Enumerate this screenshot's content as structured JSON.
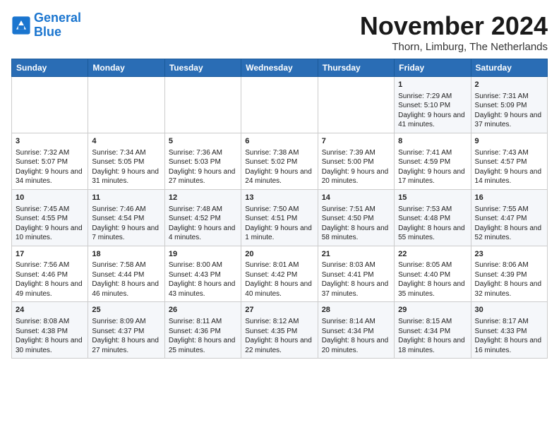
{
  "header": {
    "logo_line1": "General",
    "logo_line2": "Blue",
    "month": "November 2024",
    "location": "Thorn, Limburg, The Netherlands"
  },
  "days_of_week": [
    "Sunday",
    "Monday",
    "Tuesday",
    "Wednesday",
    "Thursday",
    "Friday",
    "Saturday"
  ],
  "weeks": [
    [
      {
        "day": "",
        "info": ""
      },
      {
        "day": "",
        "info": ""
      },
      {
        "day": "",
        "info": ""
      },
      {
        "day": "",
        "info": ""
      },
      {
        "day": "",
        "info": ""
      },
      {
        "day": "1",
        "info": "Sunrise: 7:29 AM\nSunset: 5:10 PM\nDaylight: 9 hours and 41 minutes."
      },
      {
        "day": "2",
        "info": "Sunrise: 7:31 AM\nSunset: 5:09 PM\nDaylight: 9 hours and 37 minutes."
      }
    ],
    [
      {
        "day": "3",
        "info": "Sunrise: 7:32 AM\nSunset: 5:07 PM\nDaylight: 9 hours and 34 minutes."
      },
      {
        "day": "4",
        "info": "Sunrise: 7:34 AM\nSunset: 5:05 PM\nDaylight: 9 hours and 31 minutes."
      },
      {
        "day": "5",
        "info": "Sunrise: 7:36 AM\nSunset: 5:03 PM\nDaylight: 9 hours and 27 minutes."
      },
      {
        "day": "6",
        "info": "Sunrise: 7:38 AM\nSunset: 5:02 PM\nDaylight: 9 hours and 24 minutes."
      },
      {
        "day": "7",
        "info": "Sunrise: 7:39 AM\nSunset: 5:00 PM\nDaylight: 9 hours and 20 minutes."
      },
      {
        "day": "8",
        "info": "Sunrise: 7:41 AM\nSunset: 4:59 PM\nDaylight: 9 hours and 17 minutes."
      },
      {
        "day": "9",
        "info": "Sunrise: 7:43 AM\nSunset: 4:57 PM\nDaylight: 9 hours and 14 minutes."
      }
    ],
    [
      {
        "day": "10",
        "info": "Sunrise: 7:45 AM\nSunset: 4:55 PM\nDaylight: 9 hours and 10 minutes."
      },
      {
        "day": "11",
        "info": "Sunrise: 7:46 AM\nSunset: 4:54 PM\nDaylight: 9 hours and 7 minutes."
      },
      {
        "day": "12",
        "info": "Sunrise: 7:48 AM\nSunset: 4:52 PM\nDaylight: 9 hours and 4 minutes."
      },
      {
        "day": "13",
        "info": "Sunrise: 7:50 AM\nSunset: 4:51 PM\nDaylight: 9 hours and 1 minute."
      },
      {
        "day": "14",
        "info": "Sunrise: 7:51 AM\nSunset: 4:50 PM\nDaylight: 8 hours and 58 minutes."
      },
      {
        "day": "15",
        "info": "Sunrise: 7:53 AM\nSunset: 4:48 PM\nDaylight: 8 hours and 55 minutes."
      },
      {
        "day": "16",
        "info": "Sunrise: 7:55 AM\nSunset: 4:47 PM\nDaylight: 8 hours and 52 minutes."
      }
    ],
    [
      {
        "day": "17",
        "info": "Sunrise: 7:56 AM\nSunset: 4:46 PM\nDaylight: 8 hours and 49 minutes."
      },
      {
        "day": "18",
        "info": "Sunrise: 7:58 AM\nSunset: 4:44 PM\nDaylight: 8 hours and 46 minutes."
      },
      {
        "day": "19",
        "info": "Sunrise: 8:00 AM\nSunset: 4:43 PM\nDaylight: 8 hours and 43 minutes."
      },
      {
        "day": "20",
        "info": "Sunrise: 8:01 AM\nSunset: 4:42 PM\nDaylight: 8 hours and 40 minutes."
      },
      {
        "day": "21",
        "info": "Sunrise: 8:03 AM\nSunset: 4:41 PM\nDaylight: 8 hours and 37 minutes."
      },
      {
        "day": "22",
        "info": "Sunrise: 8:05 AM\nSunset: 4:40 PM\nDaylight: 8 hours and 35 minutes."
      },
      {
        "day": "23",
        "info": "Sunrise: 8:06 AM\nSunset: 4:39 PM\nDaylight: 8 hours and 32 minutes."
      }
    ],
    [
      {
        "day": "24",
        "info": "Sunrise: 8:08 AM\nSunset: 4:38 PM\nDaylight: 8 hours and 30 minutes."
      },
      {
        "day": "25",
        "info": "Sunrise: 8:09 AM\nSunset: 4:37 PM\nDaylight: 8 hours and 27 minutes."
      },
      {
        "day": "26",
        "info": "Sunrise: 8:11 AM\nSunset: 4:36 PM\nDaylight: 8 hours and 25 minutes."
      },
      {
        "day": "27",
        "info": "Sunrise: 8:12 AM\nSunset: 4:35 PM\nDaylight: 8 hours and 22 minutes."
      },
      {
        "day": "28",
        "info": "Sunrise: 8:14 AM\nSunset: 4:34 PM\nDaylight: 8 hours and 20 minutes."
      },
      {
        "day": "29",
        "info": "Sunrise: 8:15 AM\nSunset: 4:34 PM\nDaylight: 8 hours and 18 minutes."
      },
      {
        "day": "30",
        "info": "Sunrise: 8:17 AM\nSunset: 4:33 PM\nDaylight: 8 hours and 16 minutes."
      }
    ]
  ]
}
